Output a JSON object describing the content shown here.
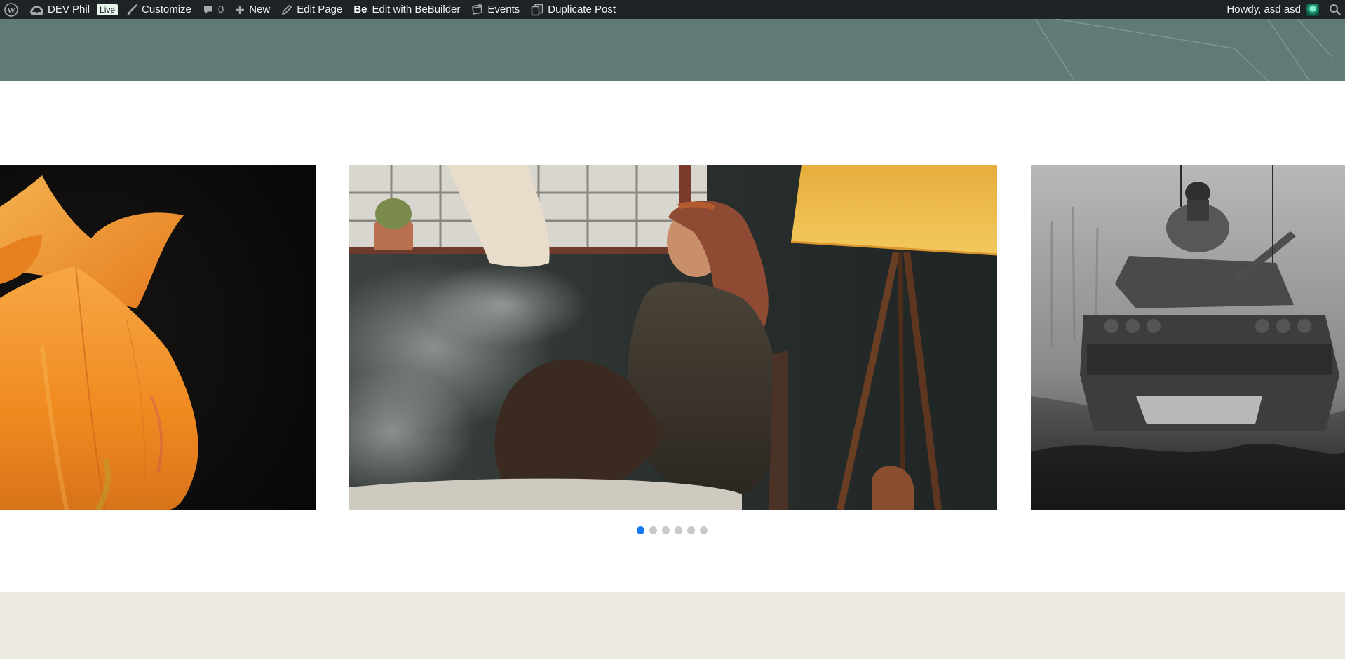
{
  "adminbar": {
    "site_name": "DEV Phil",
    "live_badge": "Live",
    "customize": "Customize",
    "comments_count": "0",
    "new": "New",
    "edit_page": "Edit Page",
    "bebuilder_logo": "Be",
    "edit_bebuilder": "Edit with BeBuilder",
    "events": "Events",
    "duplicate_post": "Duplicate Post",
    "howdy": "Howdy, asd asd"
  },
  "icons": {
    "wordpress": "wordpress-logo-icon",
    "dashboard": "dashboard-icon",
    "customize": "paintbrush-icon",
    "comments": "comment-bubble-icon",
    "new": "plus-icon",
    "edit": "pencil-icon",
    "events": "calendar-icon",
    "duplicate": "duplicate-icon",
    "search": "search-icon"
  },
  "slider": {
    "slides": [
      {
        "subject": "orange-flower-photo"
      },
      {
        "subject": "woman-smoking-by-lamp-photo"
      },
      {
        "subject": "tank-in-mud-photo"
      }
    ],
    "dot_count": 6,
    "active_index": 0
  },
  "colors": {
    "adminbar_bg": "#1d2327",
    "header_band": "#627a77",
    "footer_band": "#edeae4",
    "dot_active": "#1479f5",
    "dot_inactive": "#c9c9c9"
  }
}
